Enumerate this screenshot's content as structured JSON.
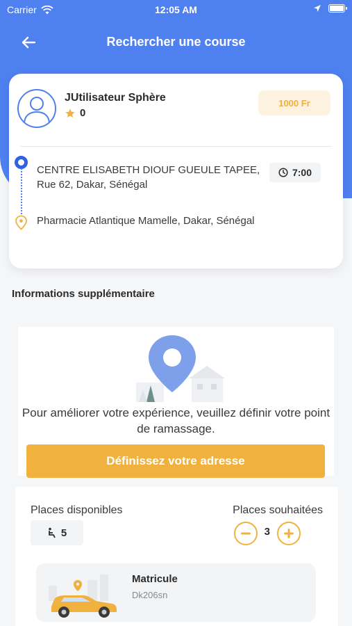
{
  "status_bar": {
    "carrier": "Carrier",
    "time": "12:05 AM"
  },
  "nav": {
    "title": "Rechercher une course",
    "back_icon": "arrow-left-icon"
  },
  "ride": {
    "user_name": "JUtilisateur Sphère",
    "rating": "0",
    "price": "1000 Fr",
    "origin": "CENTRE ELISABETH DIOUF GUEULE TAPEE, Rue 62, Dakar, Sénégal",
    "destination": "Pharmacie Atlantique Mamelle, Dakar, Sénégal",
    "time": "7:00"
  },
  "section": {
    "title": "Informations supplémentaire"
  },
  "pickup": {
    "message": "Pour améliorer votre expérience, veuillez définir votre point de ramassage.",
    "button_label": "Définissez votre adresse"
  },
  "places": {
    "available_label": "Places disponibles",
    "available_count": "5",
    "wanted_label": "Places souhaitées",
    "wanted_count": "3"
  },
  "vehicle": {
    "title": "Matricule",
    "plate": "Dk206sn"
  },
  "colors": {
    "primary": "#4f80f0",
    "accent": "#f1b13e"
  }
}
